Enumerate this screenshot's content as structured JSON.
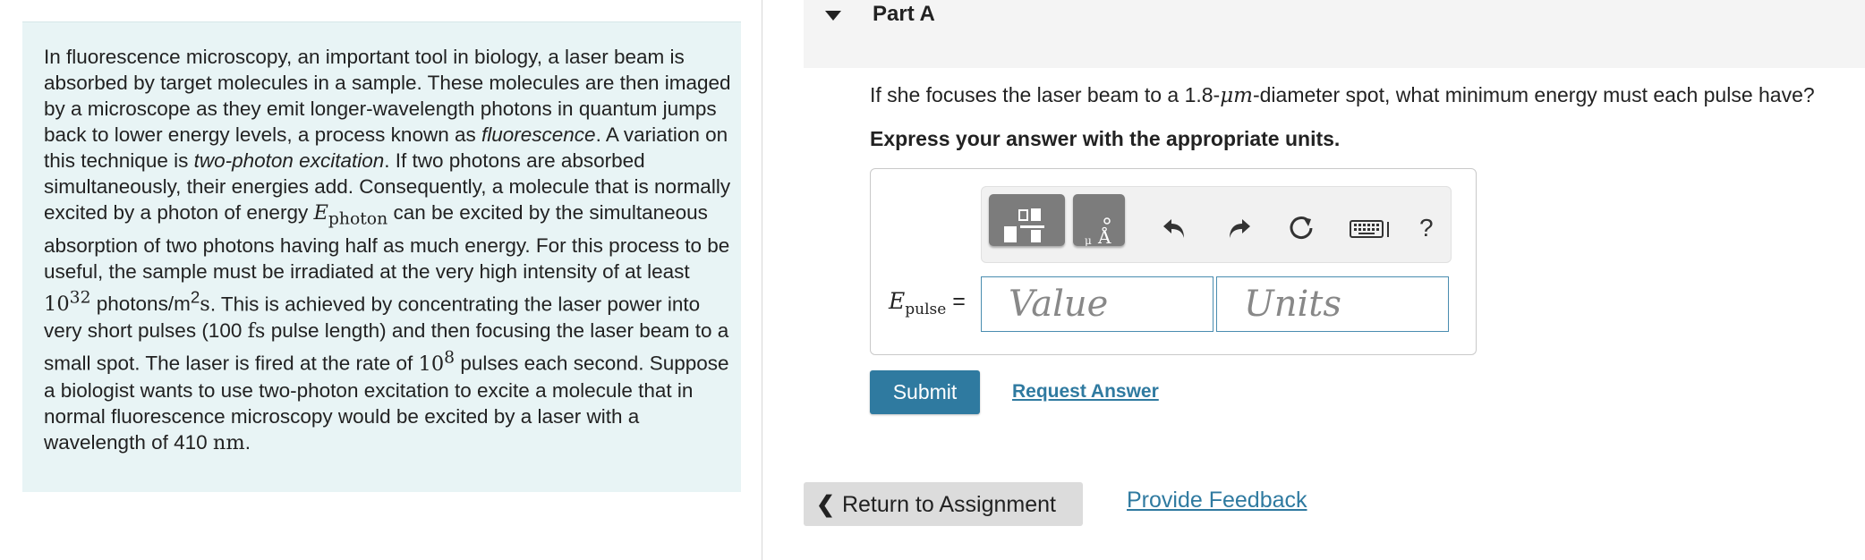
{
  "problem": {
    "p1": "In fluorescence microscopy, an important tool in biology, a laser beam is absorbed by target molecules in a sample. These molecules are then imaged by a microscope as they emit longer-wavelength photons in quantum jumps back to lower energy levels, a process known as ",
    "fluorescence": "fluorescence",
    "p2": ". A variation on this technique is ",
    "two_photon": "two-photon excitation",
    "p3": ". If two photons are absorbed simultaneously, their energies add. Consequently, a molecule that is normally excited by a photon of energy ",
    "e_symbol": "E",
    "e_sub": "photon",
    "p4": " can be excited by the simultaneous absorption of two photons having half as much energy. For this process to be useful, the sample must be irradiated at the very high intensity of at least ",
    "intensity_base": "10",
    "intensity_exp": "32",
    "intensity_unit_a": " photons/m",
    "intensity_unit_exp": "2",
    "intensity_unit_b": "s",
    "p5": ". This is achieved by concentrating the laser power into very short pulses (100 ",
    "fs_unit": "fs",
    "p6": " pulse length) and then focusing the laser beam to a small spot. The laser is fired at the rate of ",
    "rate_base": "10",
    "rate_exp": "8",
    "p7": " pulses each second. Suppose a biologist wants to use two-photon excitation to excite a molecule that in normal fluorescence microscopy would be excited by a laser with a wavelength of 410 ",
    "nm_unit": "nm",
    "p8": "."
  },
  "part": {
    "title": "Part A",
    "question_a": "If she focuses the laser beam to a 1.8-",
    "question_unit": "μm",
    "question_b": "-diameter spot, what minimum energy must each pulse have?",
    "instruction": "Express your answer with the appropriate units."
  },
  "answer": {
    "label_symbol": "E",
    "label_sub": "pulse",
    "label_eq": " =",
    "value_placeholder": "Value",
    "units_placeholder": "Units",
    "help_label": "?"
  },
  "buttons": {
    "submit": "Submit",
    "request_answer": "Request Answer",
    "return": "Return to Assignment",
    "feedback": "Provide Feedback"
  },
  "icons": {
    "caret": "caret-down-icon",
    "templates": "fraction-template-icon",
    "units": "units-angstrom-icon",
    "undo": "undo-icon",
    "redo": "redo-icon",
    "reset": "reset-icon",
    "keyboard": "keyboard-icon",
    "back": "chevron-left-icon"
  },
  "colors": {
    "panel_bg": "#e8f4f5",
    "accent": "#2f7aa0",
    "header_bg": "#f4f4f4"
  }
}
